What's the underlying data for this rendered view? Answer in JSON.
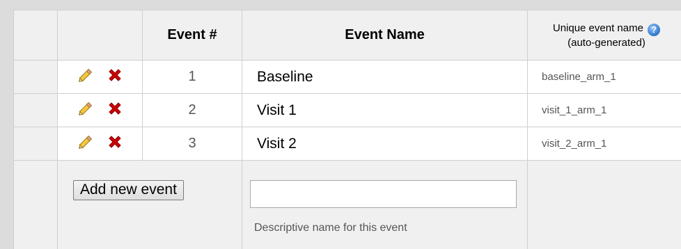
{
  "table": {
    "headers": {
      "event_num": "Event #",
      "event_name": "Event Name",
      "unique_line1": "Unique event name",
      "unique_line2": "(auto-generated)",
      "help_icon": "help-icon"
    },
    "rows": [
      {
        "num": "1",
        "name": "Baseline",
        "unique": "baseline_arm_1"
      },
      {
        "num": "2",
        "name": "Visit 1",
        "unique": "visit_1_arm_1"
      },
      {
        "num": "3",
        "name": "Visit 2",
        "unique": "visit_2_arm_1"
      }
    ]
  },
  "add": {
    "button_label": "Add new event",
    "input_value": "",
    "hint": "Descriptive name for this event"
  },
  "icons": {
    "edit": "pencil-icon",
    "delete": "delete-x-icon"
  },
  "colors": {
    "header_bg": "#f0f0f0",
    "border": "#cfcfcf",
    "delete_red": "#cc0000",
    "pencil_yellow": "#f2c744",
    "help_blue": "#3a7fd0"
  }
}
